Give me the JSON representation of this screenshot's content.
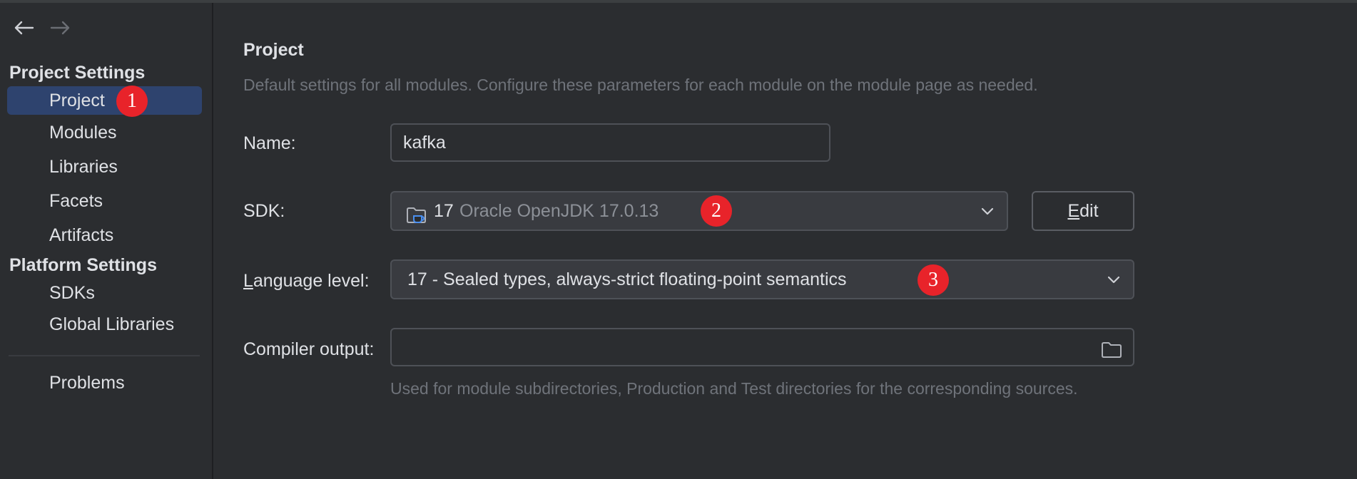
{
  "sidebar": {
    "sections": [
      {
        "title": "Project Settings",
        "items": [
          "Project",
          "Modules",
          "Libraries",
          "Facets",
          "Artifacts"
        ]
      },
      {
        "title": "Platform Settings",
        "items": [
          "SDKs",
          "Global Libraries"
        ]
      }
    ],
    "problems_label": "Problems",
    "selected_item": "Project"
  },
  "main": {
    "title": "Project",
    "description": "Default settings for all modules. Configure these parameters for each module on the module page as needed.",
    "name_field": {
      "label": "Name:",
      "value": "kafka"
    },
    "sdk_field": {
      "label": "SDK:",
      "version": "17",
      "name": "Oracle OpenJDK 17.0.13",
      "icon": "jdk-folder-icon"
    },
    "edit_button": {
      "label_prefix": "",
      "mnemonic": "E",
      "label_rest": "dit"
    },
    "language_level_field": {
      "label_mnemonic": "L",
      "label_rest": "anguage level:",
      "value": "17 - Sealed types, always-strict floating-point semantics"
    },
    "compiler_output_field": {
      "label": "Compiler output:",
      "value": "",
      "hint": "Used for module subdirectories, Production and Test directories for the corresponding sources."
    }
  },
  "annotations": [
    "1",
    "2",
    "3"
  ],
  "colors": {
    "background": "#2b2d30",
    "selection": "#2e436e",
    "badge": "#e8232a",
    "muted_text": "#6f737a",
    "text": "#dfe1e5"
  }
}
